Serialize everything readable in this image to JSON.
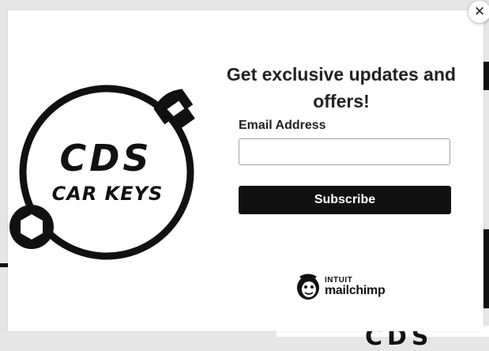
{
  "modal": {
    "headline": "Get exclusive updates and offers!",
    "email_label": "Email Address",
    "email_value": "",
    "subscribe_label": "Subscribe",
    "close_label": "✕"
  },
  "logo": {
    "line1": "CDS",
    "line2": "CAR KEYS",
    "icon": "wrench-ring-logo"
  },
  "brand": {
    "top": "INTUIT",
    "bottom": "mailchimp",
    "icon": "mailchimp-freddie-icon"
  },
  "background": {
    "partial_text": "CDS"
  },
  "colors": {
    "accent": "#111111",
    "text": "#222222",
    "overlay": "#e6e6e6"
  }
}
